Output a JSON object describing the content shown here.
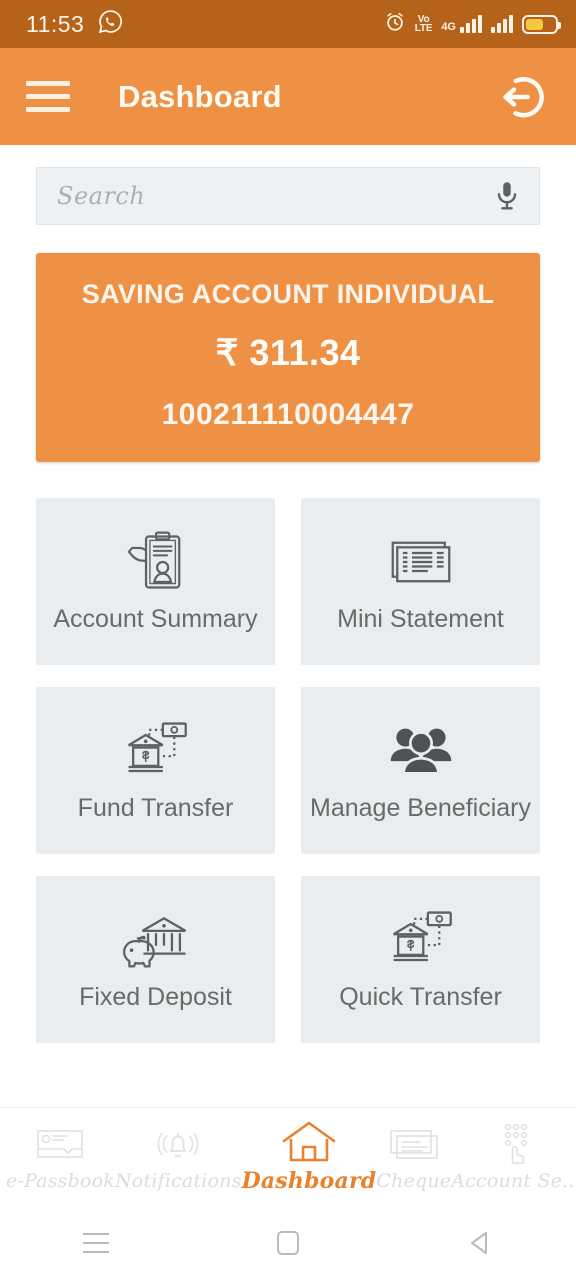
{
  "status_bar": {
    "time": "11:53",
    "whatsapp_icon": "whatsapp-icon",
    "alarm_icon": "alarm-icon",
    "volte_line1": "Vo",
    "volte_line2": "LTE",
    "network_label": "4G",
    "battery_icon": "battery-icon",
    "background": "#b5621a"
  },
  "app_bar": {
    "title": "Dashboard",
    "menu_icon": "hamburger-menu-icon",
    "logout_icon": "logout-icon",
    "background": "#ee9144"
  },
  "search": {
    "placeholder": "Search",
    "value": "",
    "mic_icon": "microphone-icon"
  },
  "account_card": {
    "type": "SAVING ACCOUNT INDIVIDUAL",
    "balance": "₹ 311.34",
    "number": "100211110004447",
    "background": "#ee9144"
  },
  "menu_grid": {
    "tiles": [
      {
        "label": "Account Summary",
        "icon": "clipboard-profile-icon"
      },
      {
        "label": "Mini Statement",
        "icon": "statement-documents-icon"
      },
      {
        "label": "Fund Transfer",
        "icon": "bank-money-transfer-icon"
      },
      {
        "label": "Manage Beneficiary",
        "icon": "people-group-icon"
      },
      {
        "label": "Fixed Deposit",
        "icon": "piggy-bank-icon"
      },
      {
        "label": "Quick Transfer",
        "icon": "bank-money-transfer-icon"
      }
    ],
    "tile_background": "#e9edf0",
    "tile_text_color": "#6a6a68"
  },
  "bottom_nav": {
    "active_color": "#e8822e",
    "inactive_color": "#d9dde1",
    "items": [
      {
        "label": "e-Passbook",
        "icon": "passbook-icon",
        "active": false
      },
      {
        "label": "Notifications",
        "icon": "bell-icon",
        "active": false
      },
      {
        "label": "Dashboard",
        "icon": "home-icon",
        "active": true
      },
      {
        "label": "Cheque",
        "icon": "cheque-icon",
        "active": false
      },
      {
        "label": "Account Se...",
        "icon": "keypad-tap-icon",
        "active": false
      }
    ]
  },
  "android_nav": {
    "recents_icon": "recents-icon",
    "home_icon": "home-square-icon",
    "back_icon": "back-triangle-icon"
  }
}
